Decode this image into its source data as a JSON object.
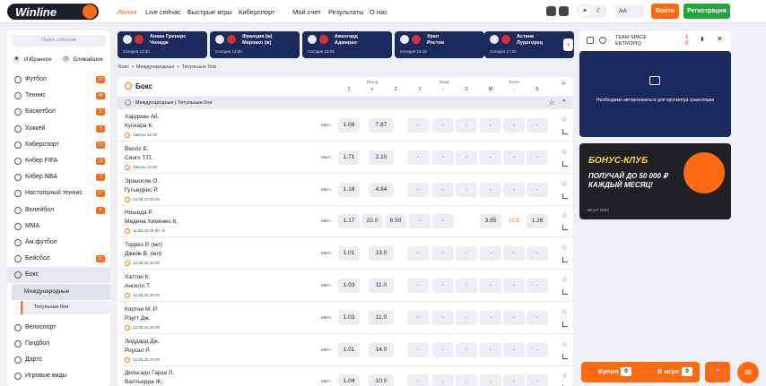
{
  "header": {
    "logo": "Winline",
    "nav": [
      "Линия",
      "Live сейчас",
      "Быстрые игры",
      "Киберспорт",
      "Мой счет",
      "Результаты",
      "О нас"
    ],
    "theme_light": "☀",
    "theme_dark": "☾",
    "font_small": "A",
    "font_large": "A",
    "font_size_label": "AA",
    "login": "Войти",
    "register": "Регистрация"
  },
  "sidebar": {
    "search_placeholder": "Поиск событий",
    "favorites": "Избранное",
    "upcoming": "Ближайшие",
    "sports": [
      {
        "label": "Футбол",
        "count": "19"
      },
      {
        "label": "Теннис",
        "count": "49"
      },
      {
        "label": "Баскетбол",
        "count": "2"
      },
      {
        "label": "Хоккей",
        "count": "3"
      },
      {
        "label": "Киберспорт",
        "count": "10"
      },
      {
        "label": "Кибер FIFA",
        "count": "10"
      },
      {
        "label": "Кибер NBA",
        "count": "3"
      },
      {
        "label": "Настольный теннис",
        "count": "17"
      },
      {
        "label": "Волейбол",
        "count": "6"
      },
      {
        "label": "MMA",
        "count": ""
      },
      {
        "label": "Ам.футбол",
        "count": ""
      },
      {
        "label": "Бейсбол",
        "count": "11"
      },
      {
        "label": "Бокс",
        "count": ""
      }
    ],
    "sub": "Международные",
    "sub2": "Титульные бои",
    "sports2": [
      {
        "label": "Велоспорт"
      },
      {
        "label": "Гандбол"
      },
      {
        "label": "Дартс"
      },
      {
        "label": "Игровые виды"
      }
    ]
  },
  "ticker": [
    {
      "t1": "Анкан Гринерс",
      "t2": "Чонкдж",
      "time": "Сегодня 13:30"
    },
    {
      "t1": "Франция (ж)",
      "t2": "Марокко (ж)",
      "time": "Сегодня 14:00"
    },
    {
      "t1": "Авангард",
      "t2": "Адмирал",
      "time": "Сегодня 15:00"
    },
    {
      "t1": "Урал",
      "t2": "Ростов",
      "time": "Сегодня 16:15"
    },
    {
      "t1": "Астана",
      "t2": "Лудогорец",
      "time": "Сегодня 17:00"
    }
  ],
  "breadcrumb": [
    "Бокс",
    "Международные",
    "Титульные бои"
  ],
  "main": {
    "sport": "Бокс",
    "tournament": "Международные | Титульные бои",
    "col_groups": [
      "Исход",
      "Фора",
      "Тотал"
    ],
    "cols": [
      "1",
      "x",
      "2",
      "1",
      "-",
      "2",
      "М",
      "-",
      "Б"
    ],
    "events": [
      {
        "n1": "Хардман Ай.",
        "n2": "Куохара К.",
        "date": "Завтра 12:30",
        "type": "Матч",
        "odds": [
          "1.08",
          "7.87",
          "-",
          "-",
          "-",
          "-",
          "-",
          "-"
        ]
      },
      {
        "n1": "Веллс Б.",
        "n2": "Сингх Т.П.",
        "date": "Завтра 12:30",
        "type": "Матч",
        "odds": [
          "1.71",
          "2.10",
          "-",
          "-",
          "-",
          "-",
          "-",
          "-"
        ]
      },
      {
        "n1": "Эраносян О.",
        "n2": "Гутьеррес Р.",
        "date": "10.08.23 04:00",
        "type": "Матч",
        "odds": [
          "1.18",
          "4.84",
          "-",
          "-",
          "-",
          "-",
          "-",
          "-"
        ]
      },
      {
        "n1": "Нишида Р.",
        "n2": "Медина Хименес К.",
        "date": "11.08.23 08:00 +5",
        "type": "Матч",
        "odds": [
          "1.17",
          "22.0",
          "6.50",
          "-",
          "-",
          "3.85",
          "10.5",
          "1.26"
        ]
      },
      {
        "n1": "Торрез Р. (мл)",
        "n2": "Джейк В. (мл)",
        "date": "12.08.23 20:00",
        "type": "Матч",
        "odds": [
          "1.01",
          "13.0",
          "-",
          "-",
          "-",
          "-",
          "-",
          "-"
        ]
      },
      {
        "n1": "Хаттон К.",
        "n2": "Анселл Т.",
        "date": "12.08.23 20:00",
        "type": "Матч",
        "odds": [
          "1.03",
          "11.0",
          "-",
          "-",
          "-",
          "-",
          "-",
          "-"
        ]
      },
      {
        "n1": "Кортни М. Р.",
        "n2": "Рэугт Дж.",
        "date": "12.08.23 20:00",
        "type": "Матч",
        "odds": [
          "1.03",
          "11.0",
          "-",
          "-",
          "-",
          "-",
          "-",
          "-"
        ]
      },
      {
        "n1": "Лиддард Дж.",
        "n2": "Роусал Р.",
        "date": "12.08.23 20:00",
        "type": "Матч",
        "odds": [
          "1.01",
          "14.0",
          "-",
          "-",
          "-",
          "-",
          "-",
          "-"
        ]
      },
      {
        "n1": "Дельгадо Гарза Л.",
        "n2": "Валтьерра Ж.",
        "date": "",
        "type": "Матч",
        "odds": [
          "1.04",
          "10.0",
          "-",
          "-",
          "-",
          "-",
          "-",
          "-"
        ]
      }
    ]
  },
  "right": {
    "team1": "TEAM SPACE",
    "team2": "ENTROPIQ",
    "score1": "1",
    "score2": "0",
    "video_text": "Необходимо авторизоваться для просмотра трансляции",
    "promo1": "БОНУС-КЛУБ",
    "promo2": "ПОЛУЧАЙ ДО 50 000 ₽ КАЖДЫЙ МЕСЯЦ!",
    "promo3": "Август 2023"
  },
  "betslip": {
    "coupon": "Купон",
    "coupon_n": "0",
    "live": "В игре",
    "live_n": "0"
  }
}
